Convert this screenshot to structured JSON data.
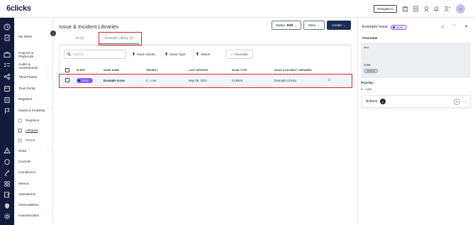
{
  "app": {
    "logo_text": "6clicks",
    "navigate_label": "Navigate to",
    "avatar_initials": "JD"
  },
  "sidebar": {
    "collapse_icon": "‹",
    "items": [
      {
        "label": "My Tasks"
      },
      {
        "label": "Projects & Playbooks"
      },
      {
        "label": "Audits & Assessments"
      },
      {
        "label": "Third-Parties"
      },
      {
        "label": "Trust Portal"
      },
      {
        "label": "Registers"
      },
      {
        "label": "Issues & Incidents"
      },
      {
        "label": "Registers"
      },
      {
        "label": "Libraries"
      },
      {
        "label": "Forms"
      },
      {
        "label": "Risks"
      },
      {
        "label": "Controls"
      },
      {
        "label": "Compliance"
      },
      {
        "label": "Metrics"
      },
      {
        "label": "Attestations"
      },
      {
        "label": "Vulnerabilities"
      },
      {
        "label": "Administration"
      }
    ]
  },
  "header": {
    "title": "Issue & Incident Libraries",
    "status_label": "Status:",
    "status_value": "Edit",
    "more_label": "More",
    "create_label": "Create"
  },
  "tabs": [
    {
      "label": "All (1)"
    },
    {
      "label": "Example Library (1)"
    }
  ],
  "toolbar": {
    "search_placeholder": "Search...",
    "filters": [
      "Issue Librari...",
      "Issue Type",
      "Status"
    ],
    "favourite_label": "Favourite"
  },
  "table": {
    "columns": [
      "ID REF",
      "ISSUE NAME",
      "PRIORITY",
      "LAST UPDATED",
      "ISSUE TYPE",
      "ISSUE & INCIDENT LIBRARIES"
    ],
    "rows": [
      {
        "id": "24.01",
        "name": "Example Issue",
        "priority": "4 - Low",
        "updated": "May 06, 2024",
        "type": "Incident",
        "library": "Example Library"
      }
    ]
  },
  "detail": {
    "title": "Example Issue",
    "badge": "24.01",
    "overview_label": "Overview",
    "desc_label": "desc",
    "type_label": "TYPE",
    "type_value": "Incident",
    "priority_label": "Priority:",
    "priority_value": "4 - Low",
    "actions_label": "Actions",
    "actions_count": "0"
  },
  "colors": {
    "rail": "#141a3c",
    "accent": "#8b5cf6",
    "highlight": "#d62828",
    "create": "#1a2e55"
  }
}
